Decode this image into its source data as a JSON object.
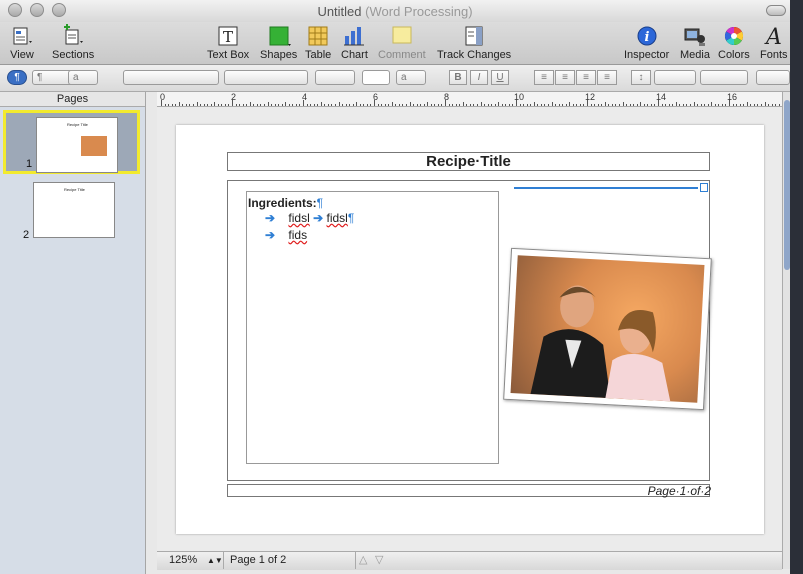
{
  "window": {
    "title": "Untitled",
    "subtitle": "(Word Processing)"
  },
  "toolbar": {
    "view": "View",
    "sections": "Sections",
    "text_box": "Text Box",
    "shapes": "Shapes",
    "table": "Table",
    "chart": "Chart",
    "comment": "Comment",
    "track_changes": "Track Changes",
    "inspector": "Inspector",
    "media": "Media",
    "colors": "Colors",
    "fonts": "Fonts"
  },
  "formatbar": {
    "para_style": "¶",
    "char_style": "a",
    "font_size_hint": "a"
  },
  "sidebar": {
    "header": "Pages",
    "pages": [
      {
        "number": "1",
        "selected": true
      },
      {
        "number": "2",
        "selected": false
      }
    ],
    "thumb_title": "Recipe Title"
  },
  "ruler": {
    "marks": [
      "0",
      "2",
      "4",
      "6",
      "8",
      "10",
      "12",
      "14",
      "16"
    ]
  },
  "document": {
    "title": "Recipe·Title",
    "ingredients_heading": "Ingredients:",
    "pilcrow": "¶",
    "bullet_arrow": "➔",
    "items": [
      {
        "text": "fidsl",
        "second": "fidsl"
      },
      {
        "text": "fids"
      }
    ],
    "footer": "Page·1·of·2"
  },
  "statusbar": {
    "zoom": "125%",
    "page_info": "Page 1 of 2"
  },
  "colors": {
    "accent": "#2f7fd4",
    "selection": "#f2ea2e"
  }
}
